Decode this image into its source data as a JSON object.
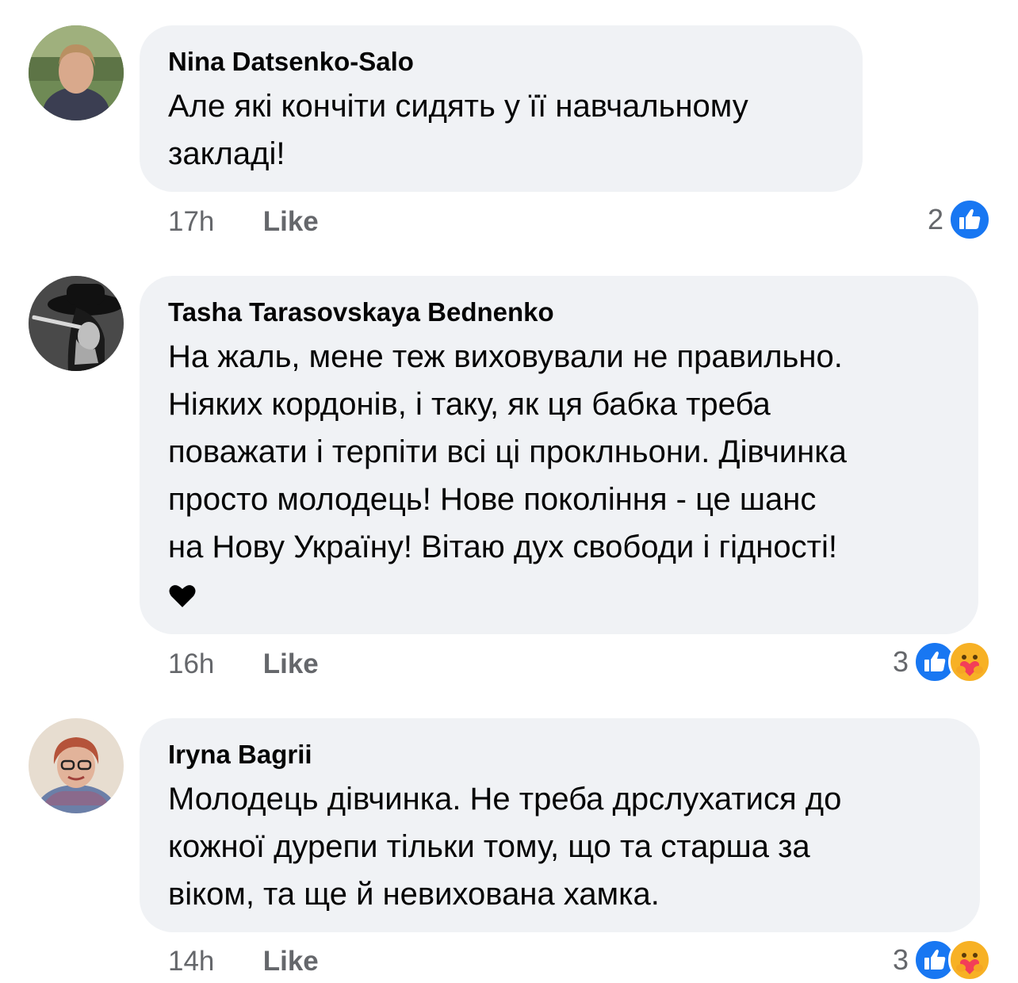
{
  "comments": [
    {
      "author": "Nina Datsenko-Salo",
      "lines": [
        "Але які кончіти сидять у її навчальному",
        "закладі!"
      ],
      "time": "17h",
      "like_label": "Like",
      "reaction_count": "2",
      "reactions": [
        "like"
      ],
      "avatar": "photo"
    },
    {
      "author": "Tasha Tarasovskaya Bednenko",
      "lines": [
        "На жаль, мене теж виховували не правильно.",
        "Ніяких кордонів, і таку, як ця бабка треба",
        "поважати і терпіти всі ці проклньони. Дівчинка",
        "просто молодець! Нове покоління - це шанс",
        "на Нову Україну! Вітаю дух свободи і гідності!"
      ],
      "emoji": "black-heart",
      "time": "16h",
      "like_label": "Like",
      "reaction_count": "3",
      "reactions": [
        "like",
        "care"
      ],
      "avatar": "photo"
    },
    {
      "author": "Iryna Bagrii",
      "lines": [
        "Молодець дівчинка. Не треба дрслухатися до",
        "кожної дурепи тільки тому, що та старша за",
        "віком, та ще й невихована хамка."
      ],
      "time": "14h",
      "like_label": "Like",
      "reaction_count": "3",
      "reactions": [
        "like",
        "care"
      ],
      "avatar": "photo"
    }
  ],
  "colors": {
    "bubble": "#f0f2f5",
    "meta_text": "#65676b",
    "like_blue": "#1877f2",
    "care_yellow": "#f7b125"
  }
}
